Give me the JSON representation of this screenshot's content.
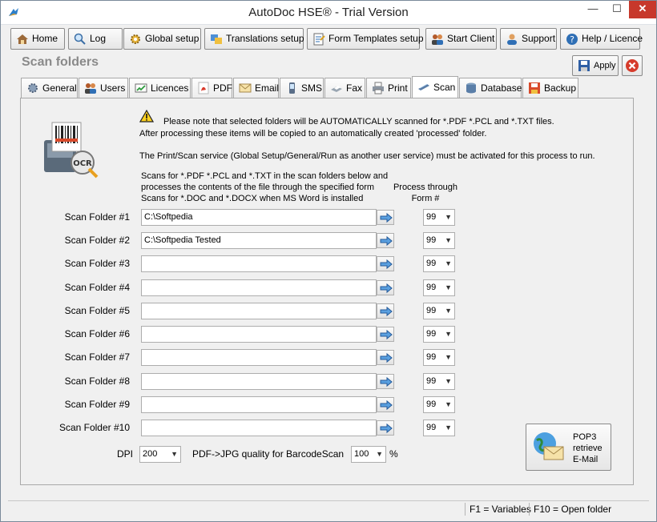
{
  "window": {
    "title": "AutoDoc HSE® - Trial Version",
    "controls": {
      "minimize": "—",
      "maximize": "☐",
      "close": "✕"
    }
  },
  "toolbar": {
    "buttons": [
      {
        "label": "Home",
        "icon": "home-icon"
      },
      {
        "label": "Log",
        "icon": "log-icon"
      },
      {
        "label": "Global setup",
        "icon": "gear-icon"
      },
      {
        "label": "Translations setup",
        "icon": "translate-icon"
      },
      {
        "label": "Form Templates setup",
        "icon": "form-icon"
      },
      {
        "label": "Start Client",
        "icon": "users-icon"
      },
      {
        "label": "Support",
        "icon": "support-icon"
      },
      {
        "label": "Help / Licence",
        "icon": "help-icon"
      }
    ]
  },
  "page": {
    "heading": "Scan folders",
    "apply_label": "Apply"
  },
  "tabs": [
    {
      "label": "General",
      "icon": "general-icon",
      "active": false
    },
    {
      "label": "Users",
      "icon": "users-icon",
      "active": false
    },
    {
      "label": "Licences",
      "icon": "licences-icon",
      "active": false
    },
    {
      "label": "PDF",
      "icon": "pdf-icon",
      "active": false
    },
    {
      "label": "Email",
      "icon": "email-icon",
      "active": false
    },
    {
      "label": "SMS",
      "icon": "sms-icon",
      "active": false
    },
    {
      "label": "Fax",
      "icon": "fax-icon",
      "active": false
    },
    {
      "label": "Print",
      "icon": "print-icon",
      "active": false
    },
    {
      "label": "Scan",
      "icon": "scan-icon",
      "active": true
    },
    {
      "label": "Database",
      "icon": "database-icon",
      "active": false
    },
    {
      "label": "Backup",
      "icon": "backup-icon",
      "active": false
    }
  ],
  "notice": {
    "line1": "Please note that selected folders will be AUTOMATICALLY scanned  for *.PDF *.PCL and *.TXT files.",
    "line2": "After processing these items will be copied to an automatically created 'processed' folder.",
    "line3": "The Print/Scan service (Global Setup/General/Run as another user service) must be activated for this process to run."
  },
  "columns": {
    "desc1": "Scans for *.PDF *.PCL and *.TXT in the scan folders below and",
    "desc2": "processes the contents of the file through the specified form",
    "desc3": "Scans for *.DOC and *.DOCX when MS Word is installed",
    "form1": "Process through",
    "form2": "Form #"
  },
  "folders": [
    {
      "label": "Scan Folder #1",
      "path": "C:\\Softpedia",
      "form": "99"
    },
    {
      "label": "Scan Folder #2",
      "path": "C:\\Softpedia Tested",
      "form": "99"
    },
    {
      "label": "Scan Folder #3",
      "path": "",
      "form": "99"
    },
    {
      "label": "Scan Folder #4",
      "path": "",
      "form": "99"
    },
    {
      "label": "Scan Folder #5",
      "path": "",
      "form": "99"
    },
    {
      "label": "Scan Folder #6",
      "path": "",
      "form": "99"
    },
    {
      "label": "Scan Folder #7",
      "path": "",
      "form": "99"
    },
    {
      "label": "Scan Folder #8",
      "path": "",
      "form": "99"
    },
    {
      "label": "Scan Folder #9",
      "path": "",
      "form": "99"
    },
    {
      "label": "Scan Folder #10",
      "path": "",
      "form": "99"
    }
  ],
  "dpi": {
    "label": "DPI",
    "value": "200"
  },
  "quality": {
    "label": "PDF->JPG quality for BarcodeScan",
    "value": "100",
    "unit": "%"
  },
  "pop3": {
    "line1": "POP3",
    "line2": "retrieve",
    "line3": "E-Mail"
  },
  "status": {
    "f1": "F1 = Variables",
    "f10": "F10 = Open folder"
  }
}
